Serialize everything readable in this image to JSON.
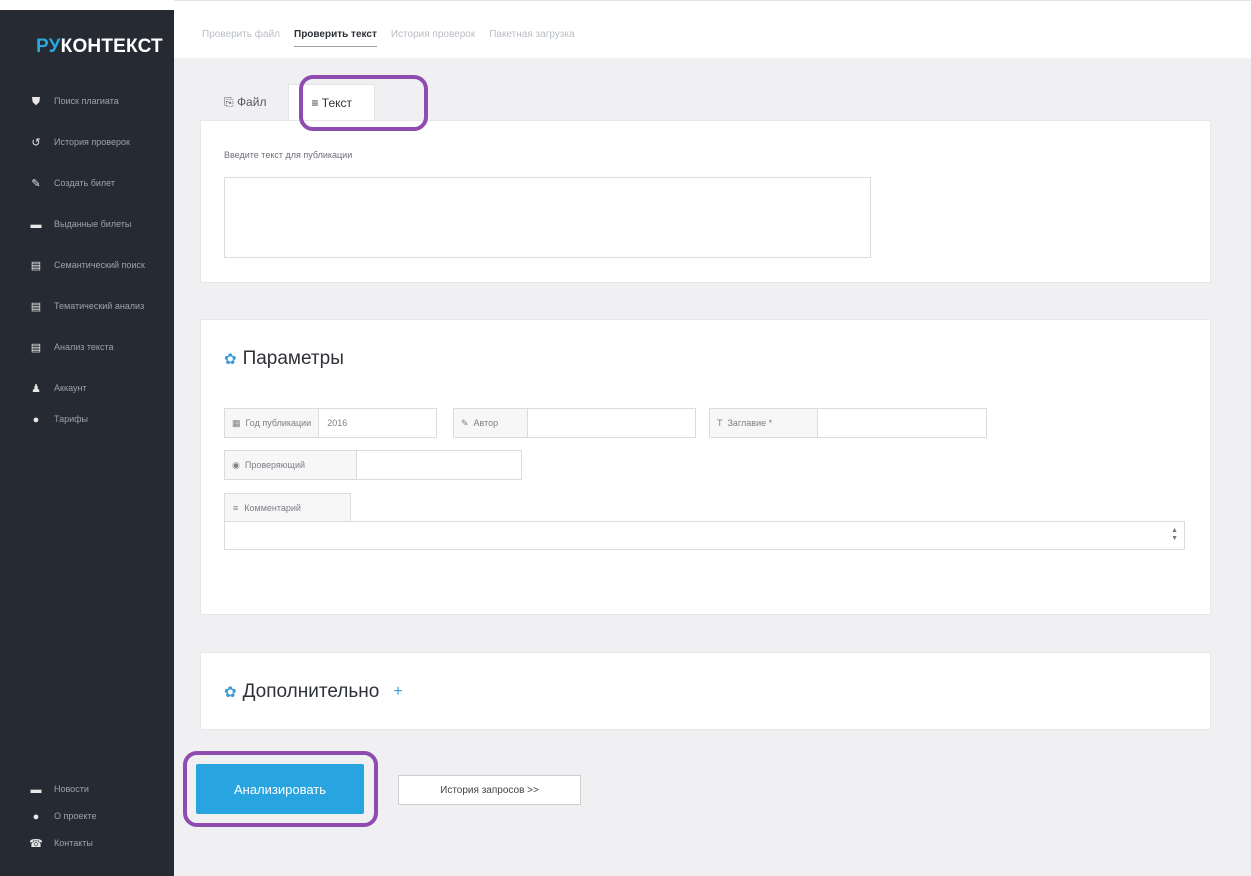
{
  "sidebar": {
    "logo_accent": "РУ",
    "logo_rest": "КОНТЕКСТ",
    "items": [
      {
        "icon": "shield-icon",
        "glyph": "⛊",
        "label": "Поиск плагиата"
      },
      {
        "icon": "history-icon",
        "glyph": "↺",
        "label": "История проверок"
      },
      {
        "icon": "pencil-icon",
        "glyph": "✎",
        "label": "Создать билет"
      },
      {
        "icon": "folder-icon",
        "glyph": "▬",
        "label": "Выданные билеты"
      },
      {
        "icon": "document-icon",
        "glyph": "▤",
        "label": "Семантический поиск"
      },
      {
        "icon": "document-icon",
        "glyph": "▤",
        "label": "Тематический анализ"
      },
      {
        "icon": "document-icon",
        "glyph": "▤",
        "label": "Анализ текста"
      },
      {
        "icon": "user-icon",
        "glyph": "♟",
        "label": "Аккаунт"
      },
      {
        "icon": "info-icon",
        "glyph": "●",
        "label": "Тарифы"
      }
    ],
    "bottom_items": [
      {
        "icon": "news-icon",
        "glyph": "▬",
        "label": "Новости"
      },
      {
        "icon": "info-icon",
        "glyph": "●",
        "label": "О проекте"
      },
      {
        "icon": "phone-icon",
        "glyph": "☎",
        "label": "Контакты"
      }
    ]
  },
  "top_tabs": [
    {
      "label": "Проверить файл",
      "active": false
    },
    {
      "label": "Проверить текст",
      "active": true
    },
    {
      "label": "История проверок",
      "active": false
    },
    {
      "label": "Пакетная загрузка",
      "active": false
    }
  ],
  "input_tabs": {
    "file_label": "Файл",
    "text_label": "Текст"
  },
  "text_input": {
    "label": "Введите текст для публикации",
    "value": ""
  },
  "params": {
    "title": "Параметры",
    "year_label": "Год публикации",
    "year_value": "2016",
    "author_label": "Автор",
    "author_value": "",
    "heading_label": "Заглавие *",
    "heading_value": "",
    "reviewer_label": "Проверяющий",
    "reviewer_value": "",
    "comment_label": "Комментарий",
    "comment_value": ""
  },
  "extra": {
    "title": "Дополнительно"
  },
  "actions": {
    "analyze": "Анализировать",
    "history": "История запросов >>"
  },
  "colors": {
    "accent": "#28a5e0",
    "sidebar_bg": "#262a33",
    "highlight": "#8e4cb0"
  }
}
